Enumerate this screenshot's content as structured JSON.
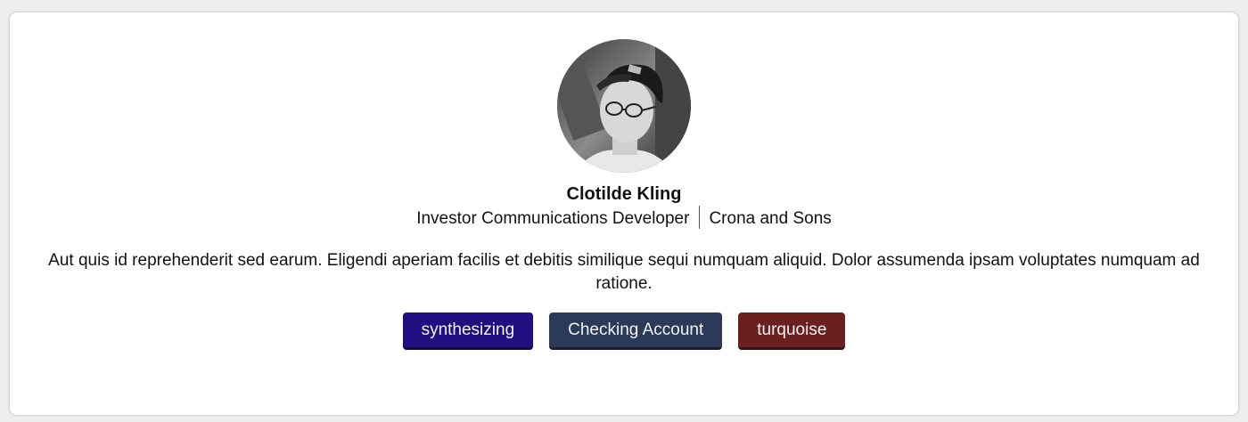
{
  "profile": {
    "name": "Clotilde Kling",
    "title": "Investor Communications Developer",
    "company": "Crona and Sons",
    "bio": "Aut quis id reprehenderit sed earum. Eligendi aperiam facilis et debitis similique sequi numquam aliquid. Dolor assumenda ipsam voluptates numquam ad ratione."
  },
  "tags": [
    {
      "label": "synthesizing",
      "color": "#1f0f80"
    },
    {
      "label": "Checking Account",
      "color": "#2c3a5a"
    },
    {
      "label": "turquoise",
      "color": "#6b2020"
    }
  ]
}
